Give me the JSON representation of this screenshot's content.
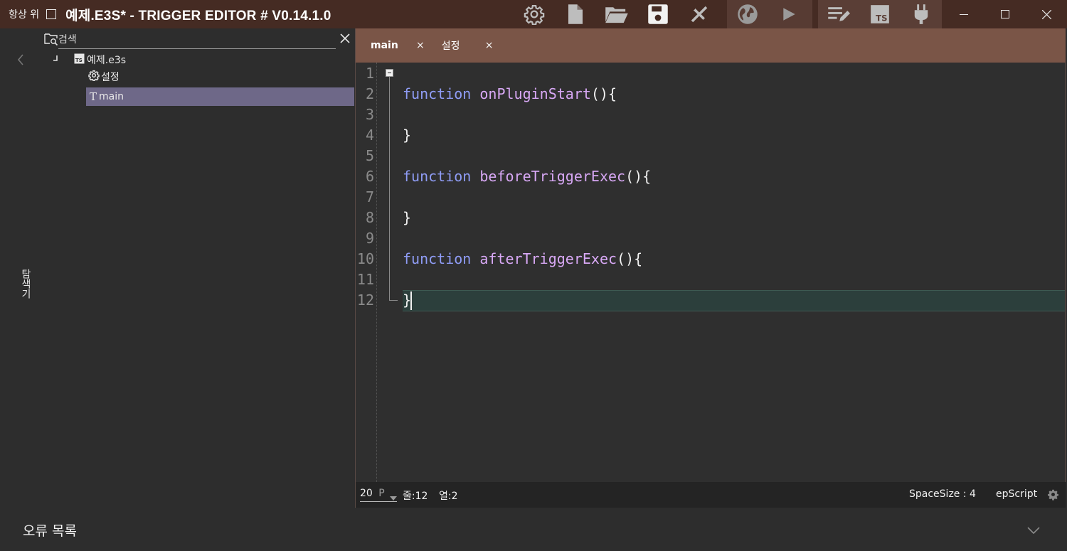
{
  "titlebar": {
    "always_on_top": "항상 위",
    "title": "예제.E3S* - TRIGGER EDITOR # V0.14.1.0",
    "toolbar_icons": [
      "gear-icon",
      "new-file-icon",
      "open-folder-icon",
      "save-icon",
      "tools-icon",
      "globe-icon",
      "play-icon",
      "edit-list-icon",
      "typescript-icon",
      "plugin-icon"
    ],
    "window_controls": [
      "minimize-icon",
      "maximize-icon",
      "close-icon"
    ]
  },
  "explorer": {
    "vertical_label": "탐색기",
    "search_placeholder": "검색",
    "tree": [
      {
        "label": "예제.e3s",
        "icon": "ts-file-icon"
      },
      {
        "label": "설정",
        "icon": "gear-icon"
      },
      {
        "label": "main",
        "icon": "text-icon",
        "selected": true
      }
    ]
  },
  "editor": {
    "tabs": [
      {
        "label": "main",
        "close": "×"
      },
      {
        "label": "설정",
        "close": "×"
      }
    ],
    "line_numbers": [
      "1",
      "2",
      "3",
      "4",
      "5",
      "6",
      "7",
      "8",
      "9",
      "10",
      "11",
      "12"
    ],
    "code": [
      {
        "line": 2,
        "keyword": "function",
        "name": "onPluginStart",
        "punct": "(){"
      },
      {
        "line": 4,
        "punct": "}"
      },
      {
        "line": 6,
        "keyword": "function",
        "name": "beforeTriggerExec",
        "punct": "(){"
      },
      {
        "line": 8,
        "punct": "}"
      },
      {
        "line": 10,
        "keyword": "function",
        "name": "afterTriggerExec",
        "punct": "(){"
      },
      {
        "line": 12,
        "punct": "}"
      }
    ],
    "status": {
      "font_size": "20",
      "font_unit": "P",
      "line": "줄:12",
      "column": "열:2",
      "space_size": "SpaceSize : 4",
      "language": "epScript"
    }
  },
  "error_panel": {
    "title": "오류 목록"
  },
  "colors": {
    "titlebar": "#452b23",
    "tabs": "#7a5547",
    "keyword": "#8f9cf5",
    "function_name": "#d8a8f5",
    "selection": "#6e6888"
  }
}
